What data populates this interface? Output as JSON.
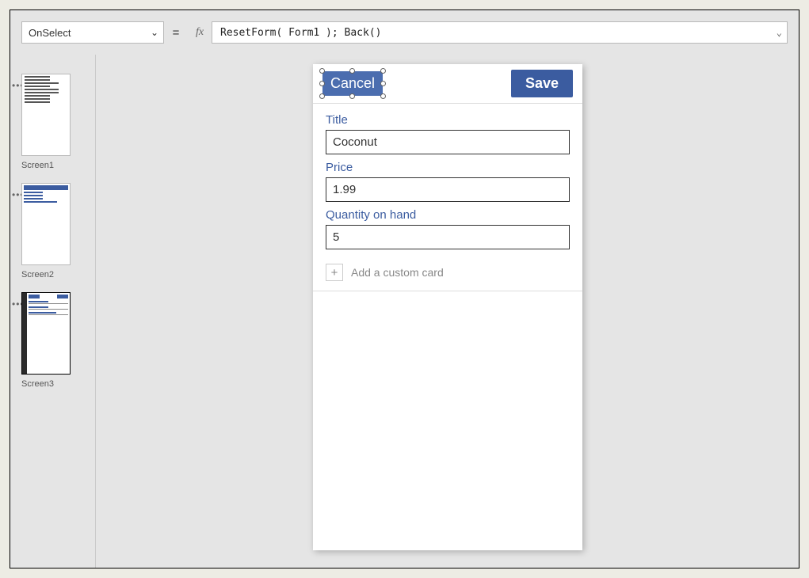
{
  "formulaBar": {
    "property": "OnSelect",
    "equals": "=",
    "fxLabel": "fx",
    "formula": "ResetForm( Form1 ); Back()"
  },
  "screensPanel": {
    "screens": [
      {
        "label": "Screen1"
      },
      {
        "label": "Screen2"
      },
      {
        "label": "Screen3"
      }
    ],
    "moreDots": "•••"
  },
  "appScreen": {
    "cancelLabel": "Cancel",
    "saveLabel": "Save",
    "fields": [
      {
        "label": "Title",
        "value": "Coconut"
      },
      {
        "label": "Price",
        "value": "1.99"
      },
      {
        "label": "Quantity on hand",
        "value": "5"
      }
    ],
    "addCardLabel": "Add a custom card",
    "plusGlyph": "+"
  }
}
